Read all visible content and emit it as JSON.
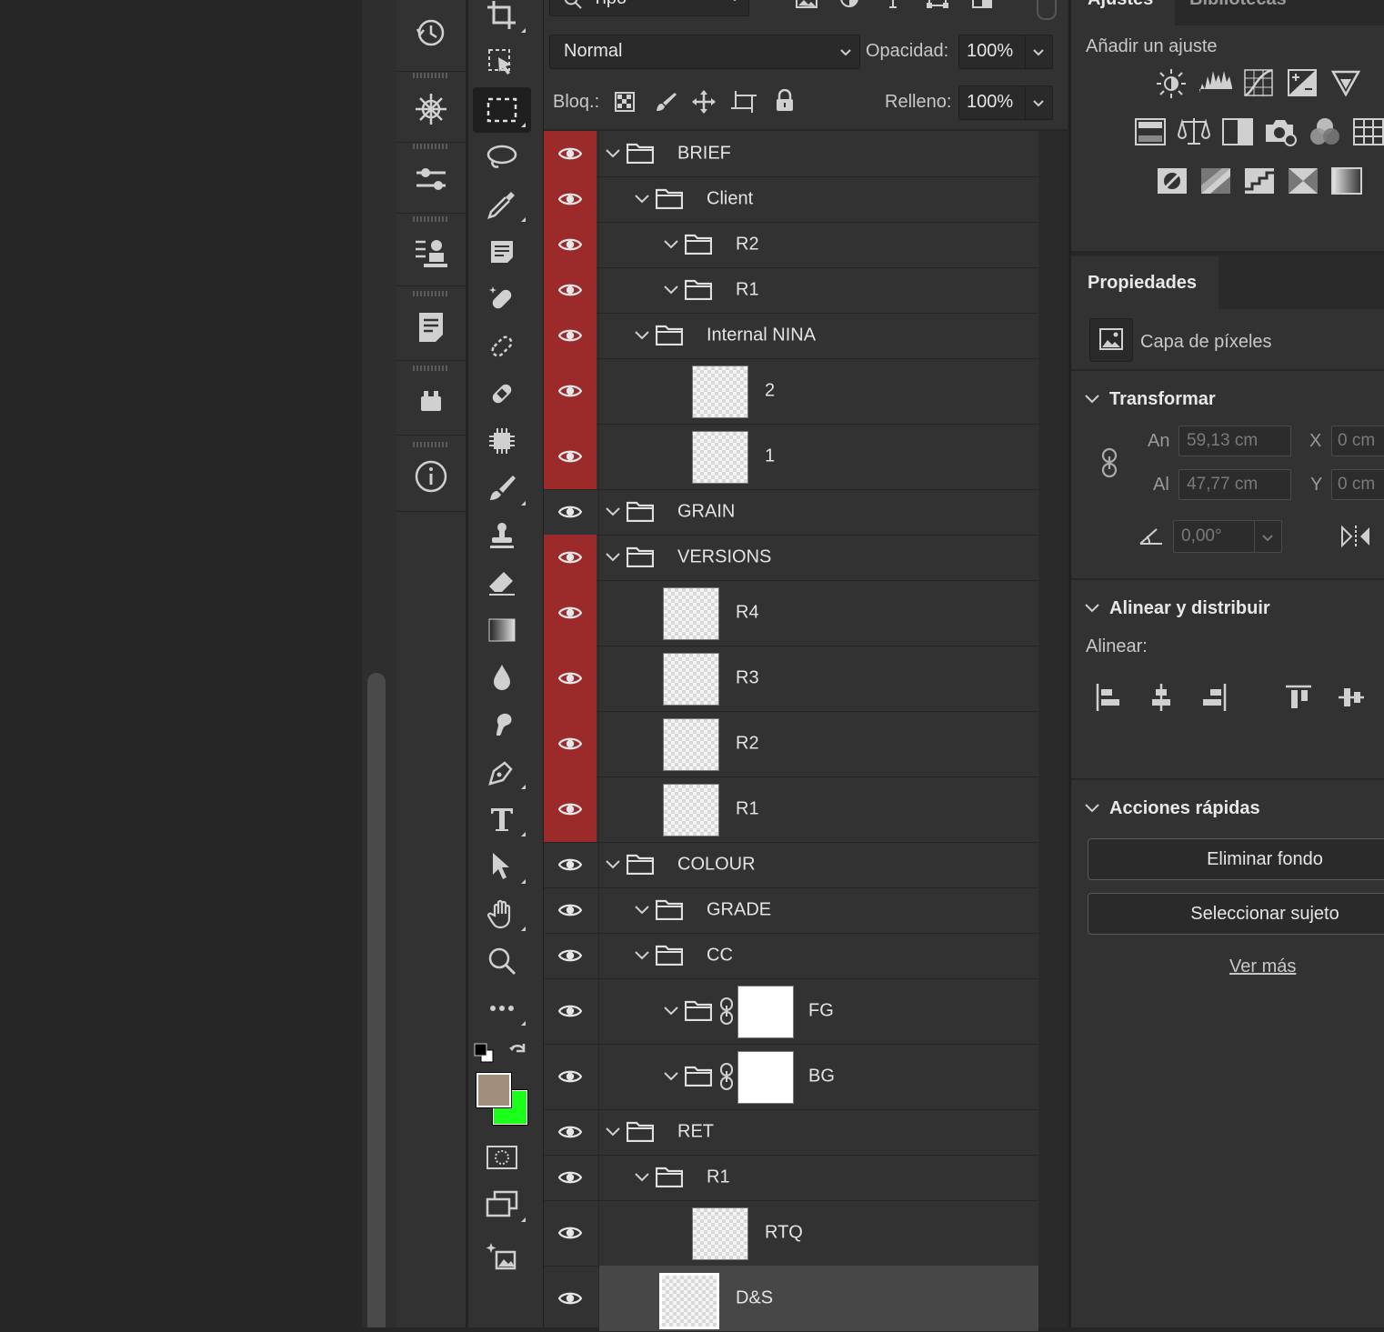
{
  "layers_panel": {
    "filter": {
      "value": "Tipo"
    },
    "blend_mode": "Normal",
    "opacity_label": "Opacidad:",
    "opacity_value": "100%",
    "lock_label": "Bloq.:",
    "fill_label": "Relleno:",
    "fill_value": "100%",
    "layers": [
      {
        "name": "BRIEF",
        "type": "group",
        "visible_highlight": true
      },
      {
        "name": "Client",
        "type": "group",
        "visible_highlight": true
      },
      {
        "name": "R2",
        "type": "group",
        "visible_highlight": true
      },
      {
        "name": "R1",
        "type": "group",
        "visible_highlight": true
      },
      {
        "name": "Internal NINA",
        "type": "group",
        "visible_highlight": true
      },
      {
        "name": "2",
        "type": "pixel",
        "visible_highlight": true
      },
      {
        "name": "1",
        "type": "pixel",
        "visible_highlight": true
      },
      {
        "name": "GRAIN",
        "type": "group",
        "visible_highlight": false
      },
      {
        "name": "VERSIONS",
        "type": "group",
        "visible_highlight": true
      },
      {
        "name": "R4",
        "type": "pixel",
        "visible_highlight": true
      },
      {
        "name": "R3",
        "type": "pixel",
        "visible_highlight": true
      },
      {
        "name": "R2",
        "type": "pixel",
        "visible_highlight": true
      },
      {
        "name": "R1",
        "type": "pixel",
        "visible_highlight": true
      },
      {
        "name": "COLOUR",
        "type": "group",
        "visible_highlight": false
      },
      {
        "name": "GRADE",
        "type": "group",
        "visible_highlight": false
      },
      {
        "name": "CC",
        "type": "group",
        "visible_highlight": false
      },
      {
        "name": "FG",
        "type": "group-mask",
        "visible_highlight": false
      },
      {
        "name": "BG",
        "type": "group-mask",
        "visible_highlight": false
      },
      {
        "name": "RET",
        "type": "group",
        "visible_highlight": false
      },
      {
        "name": "R1",
        "type": "group",
        "visible_highlight": false
      },
      {
        "name": "RTQ",
        "type": "pixel",
        "visible_highlight": false
      },
      {
        "name": "D&S",
        "type": "pixel",
        "visible_highlight": false,
        "selected": true
      }
    ]
  },
  "right_panel": {
    "tabs": [
      "Ajustes",
      "Bibliotecas"
    ],
    "add_adjustment": "Añadir un ajuste",
    "properties_tab": "Propiedades",
    "layer_kind": "Capa de píxeles",
    "transform": {
      "title": "Transformar",
      "w_label": "An",
      "w_value": "59,13 cm",
      "h_label": "Al",
      "h_value": "47,77 cm",
      "x_label": "X",
      "x_value": "0 cm",
      "y_label": "Y",
      "y_value": "0 cm",
      "angle_value": "0,00°"
    },
    "align": {
      "title": "Alinear y distribuir",
      "label": "Alinear:"
    },
    "quick_actions": {
      "title": "Acciones rápidas",
      "remove_bg": "Eliminar fondo",
      "select_subject": "Seleccionar sujeto",
      "see_more": "Ver más"
    }
  },
  "colors": {
    "highlight_red": "#9c2a2a",
    "foreground_color": "#a08e7a",
    "background_color": "#1aff1a",
    "panel_bg": "#323232"
  },
  "icons": {
    "dock": [
      "history-icon",
      "properties-icon",
      "adjust-icon",
      "styles-icon",
      "notes-icon",
      "plugins-icon",
      "info-icon"
    ],
    "tools": [
      "crop-icon",
      "object-select-icon",
      "marquee-icon",
      "lasso-icon",
      "eyedropper-icon",
      "note-icon",
      "healing-icon",
      "patch-icon",
      "bandage-icon",
      "chip-icon",
      "brush-icon",
      "stamp-icon",
      "eraser-icon",
      "gradient-icon",
      "drop-icon",
      "smudge-icon",
      "pen-icon",
      "type-icon",
      "path-select-icon",
      "hand-icon",
      "zoom-icon",
      "more-icon"
    ]
  }
}
